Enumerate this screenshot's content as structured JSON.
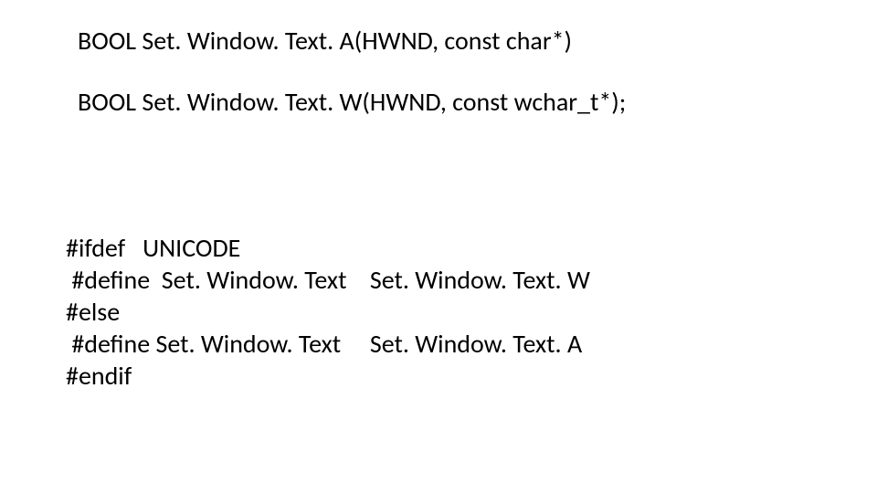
{
  "lines": {
    "decl_a": "BOOL Set. Window. Text. A(HWND, const char*)",
    "decl_w": "BOOL Set. Window. Text. W(HWND, const wchar_t*);",
    "ifdef": "#ifdef   UNICODE",
    "define_w": " #define  Set. Window. Text    Set. Window. Text. W",
    "else": "#else",
    "define_a": " #define Set. Window. Text     Set. Window. Text. A",
    "endif": "#endif"
  }
}
